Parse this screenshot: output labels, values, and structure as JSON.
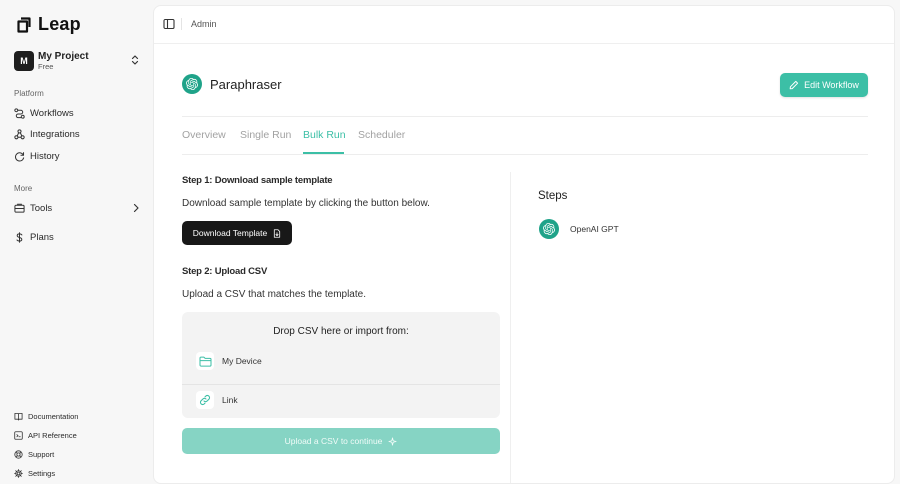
{
  "brand": {
    "name": "Leap"
  },
  "project": {
    "initial": "M",
    "name": "My Project",
    "plan": "Free"
  },
  "sidebar": {
    "platform_label": "Platform",
    "platform_items": [
      {
        "label": "Workflows",
        "icon": "workflow-icon"
      },
      {
        "label": "Integrations",
        "icon": "integrations-icon"
      },
      {
        "label": "History",
        "icon": "history-icon"
      }
    ],
    "more_label": "More",
    "more_items": [
      {
        "label": "Tools",
        "icon": "tools-icon"
      },
      {
        "label": "Plans",
        "icon": "dollar-icon"
      }
    ],
    "footer_items": [
      {
        "label": "Documentation",
        "icon": "book-icon"
      },
      {
        "label": "API Reference",
        "icon": "code-icon"
      },
      {
        "label": "Support",
        "icon": "lifebuoy-icon"
      },
      {
        "label": "Settings",
        "icon": "gear-icon"
      }
    ]
  },
  "topbar": {
    "breadcrumb": "Admin"
  },
  "workflow": {
    "title": "Paraphraser",
    "edit_label": "Edit Workflow"
  },
  "tabs": [
    {
      "label": "Overview",
      "active": false
    },
    {
      "label": "Single Run",
      "active": false
    },
    {
      "label": "Bulk Run",
      "active": true
    },
    {
      "label": "Scheduler",
      "active": false
    }
  ],
  "bulk": {
    "step1_title": "Step 1: Download sample template",
    "step1_desc": "Download sample template by clicking the button below.",
    "download_label": "Download Template",
    "step2_title": "Step 2: Upload CSV",
    "step2_desc": "Upload a CSV that matches the template.",
    "drop_title": "Drop CSV here or import from:",
    "import_options": [
      {
        "label": "My Device",
        "icon": "folder-icon"
      },
      {
        "label": "Link",
        "icon": "link-icon"
      }
    ],
    "upload_label": "Upload a CSV to continue"
  },
  "steps_panel": {
    "title": "Steps",
    "items": [
      {
        "label": "OpenAI GPT",
        "icon": "openai-icon"
      }
    ]
  },
  "colors": {
    "accent": "#3cbfa6",
    "accent_disabled": "#86d4c4",
    "dark_button": "#181818"
  }
}
